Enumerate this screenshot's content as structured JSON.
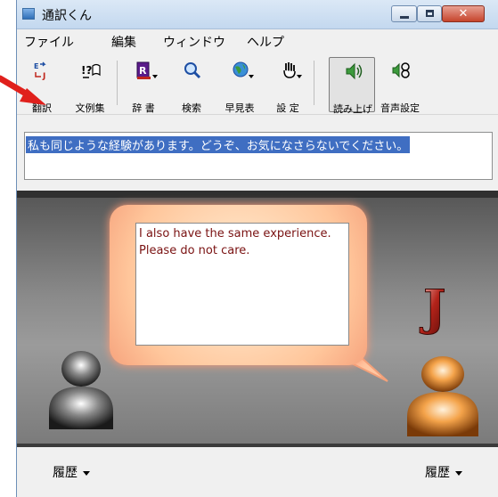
{
  "window": {
    "title": "通訳くん",
    "controls": [
      "minimize",
      "maximize",
      "close"
    ]
  },
  "menu": [
    {
      "label": "ファイル"
    },
    {
      "label": "編集"
    },
    {
      "label": "ウィンドウ"
    },
    {
      "label": "ヘルプ"
    }
  ],
  "toolbar": {
    "buttons": [
      {
        "label": "翻訳",
        "icon": "translate-icon",
        "pressed": false,
        "dropdown": false
      },
      {
        "label": "文例集",
        "icon": "examples-icon",
        "pressed": false,
        "dropdown": false
      },
      {
        "label": "辞 書",
        "icon": "dictionary-icon",
        "pressed": false,
        "dropdown": true
      },
      {
        "label": "検索",
        "icon": "search-icon",
        "pressed": false,
        "dropdown": false
      },
      {
        "label": "早見表",
        "icon": "globe-icon",
        "pressed": false,
        "dropdown": true
      },
      {
        "label": "設 定",
        "icon": "settings-icon",
        "pressed": false,
        "dropdown": true
      },
      {
        "label": "読み上げ",
        "icon": "speaker-icon",
        "pressed": true,
        "dropdown": false
      },
      {
        "label": "音声設定",
        "icon": "voice-settings-icon",
        "pressed": false,
        "dropdown": false
      }
    ]
  },
  "input": {
    "selected_text": "私も同じような経験があります。どうぞ、お気になさらないでください。"
  },
  "output": {
    "text": "I also have the same experience. Please do not care."
  },
  "history": {
    "left_label": "履歴",
    "right_label": "履歴"
  },
  "colors": {
    "selection": "#3f6ec2",
    "reply_text": "#7a1212",
    "annotation_arrow": "#e0201c"
  }
}
